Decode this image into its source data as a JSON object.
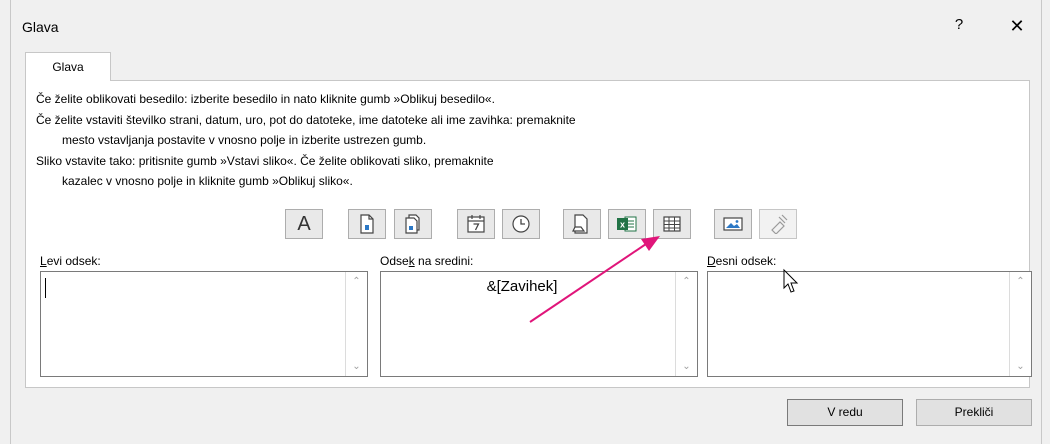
{
  "dialog": {
    "title": "Glava",
    "help_glyph": "?",
    "close_glyph": "✕"
  },
  "tab": {
    "label": "Glava"
  },
  "instructions": {
    "line1": "Če želite oblikovati besedilo: izberite besedilo in nato kliknite gumb »Oblikuj besedilo«.",
    "line2": "Če želite vstaviti številko strani, datum, uro, pot do datoteke, ime datoteke ali ime zavihka: premaknite",
    "line3": "mesto vstavljanja postavite v vnosno polje in izberite ustrezen gumb.",
    "line4": "Sliko vstavite tako: pritisnite gumb »Vstavi sliko«. Če želite oblikovati sliko, premaknite",
    "line5": "kazalec v vnosno polje in kliknite gumb »Oblikuj sliko«."
  },
  "toolbar": {
    "format_text_glyph": "A"
  },
  "sections": {
    "left": {
      "label_pre": "",
      "label_key": "L",
      "label_post": "evi odsek:",
      "value": ""
    },
    "center": {
      "label_pre": "Odse",
      "label_key": "k",
      "label_post": " na sredini:",
      "value": "&[Zavihek]"
    },
    "right": {
      "label_pre": "",
      "label_key": "D",
      "label_post": "esni odsek:",
      "value": ""
    }
  },
  "buttons": {
    "ok": "V redu",
    "cancel": "Prekliči"
  },
  "colors": {
    "annotation_arrow": "#e0157a",
    "excel_green": "#217346"
  }
}
